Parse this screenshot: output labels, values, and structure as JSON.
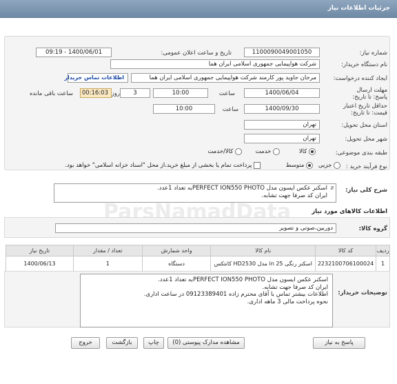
{
  "window": {
    "title": "جزئیات اطلاعات نیاز"
  },
  "fields": {
    "need_number_label": "شماره نیاز:",
    "need_number": "1100090049001050",
    "announce_label": "تاریخ و ساعت اعلان عمومی:",
    "announce_value": "1400/06/01 - 09:19",
    "buyer_org_label": "نام دستگاه خریدار:",
    "buyer_org": "شرکت هواپیمایی جمهوری اسلامی ایران هما",
    "creator_label": "ایجاد کننده درخواست:",
    "creator": "مرجان جاوید پور کارمند شرکت هواپیمایی جمهوری اسلامی ایران هما",
    "contact_link": "اطلاعات تماس خریدار",
    "deadline_label": "مهلت ارسال پاسخ: تا تاریخ:",
    "deadline_date": "1400/06/04",
    "time_label": "ساعت",
    "deadline_time": "10:00",
    "days_value": "3",
    "days_label": "روز و",
    "remaining_time": "00:16:03",
    "remaining_label": "ساعت باقی مانده",
    "validity_label": "حداقل تاریخ اعتبار قیمت: تا تاریخ:",
    "validity_date": "1400/09/30",
    "validity_time_label": "ساعت",
    "validity_time": "10:00",
    "province_label": "استان محل تحویل:",
    "province": "تهران",
    "city_label": "شهر محل تحویل:",
    "city": "تهران",
    "category_label": "طبقه بندی موضوعی:",
    "category_options": [
      "کالا",
      "خدمت",
      "کالا/خدمت"
    ],
    "process_label": "نوع فرآیند خرید :",
    "process_options": [
      "جزیی",
      "متوسط"
    ],
    "payment_note": "پرداخت تمام یا بخشی از مبلغ خرید،از محل \"اسناد خزانه اسلامی\" خواهد بود."
  },
  "summary": {
    "label": "شرح کلی نیاز:",
    "line1": "اسکنر عکس ایسون مدل PERFECT ION550 PHOTOبه تعداد 1عدد.",
    "line2": "ایران کد صرفا جهت تشابه."
  },
  "goods": {
    "section_title": "اطلاعات کالاهای مورد نیاز",
    "group_label": "گروه کالا:",
    "group_value": "دوربین،صوتی و تصویر",
    "columns": [
      "ردیف",
      "کد کالا",
      "نام کالا",
      "واحد شمارش",
      "تعداد / مقدار",
      "تاریخ نیاز"
    ],
    "rows": [
      [
        "1",
        "2232100706100024",
        "اسکنر رنگی 25 in مدل HD2530 کانتکس",
        "دستگاه",
        "1",
        "1400/06/13"
      ]
    ]
  },
  "buyer_notes": {
    "label": "توضیحات خریدار:",
    "lines": [
      "اسکنر عکس ایسون مدل PERFECT ION550 PHOTOبه تعداد 1عدد.",
      "ایران کد صرفا جهت تشابه.",
      "اطلاعات بیشتر تماس با آقای محترم زاده 09123389401 در ساعت اداری.",
      "نحوه پرداخت مالی 3 ماهه اداری."
    ]
  },
  "buttons": {
    "reply": "پاسخ به نیاز",
    "docs": "مشاهده مدارک پیوستی (0)",
    "print": "چاپ",
    "back": "بازگشت",
    "exit": "خروج"
  }
}
